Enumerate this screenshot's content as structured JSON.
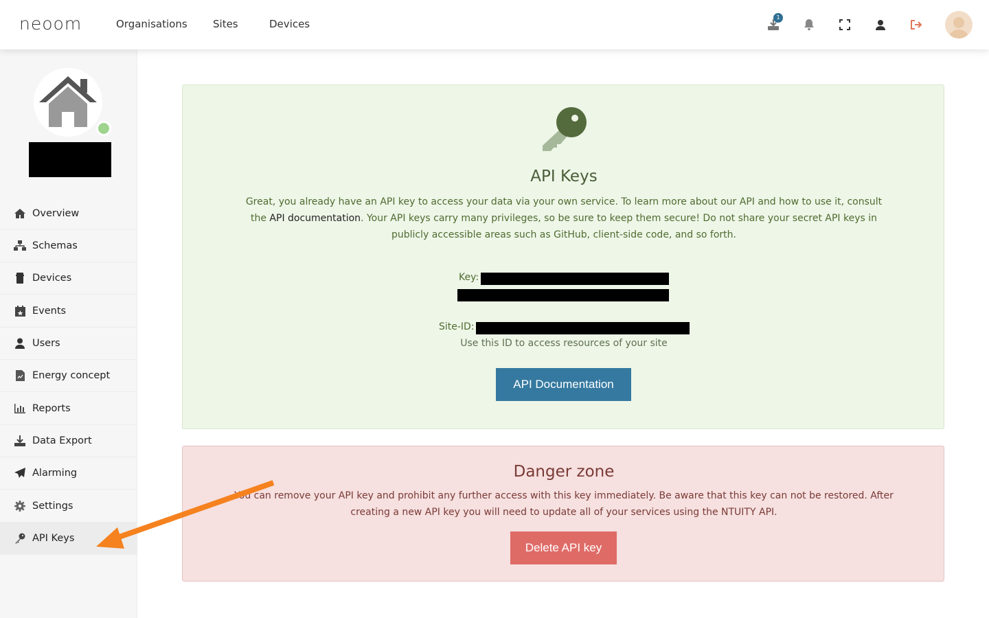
{
  "header": {
    "logo": "neoom",
    "nav": [
      "Organisations",
      "Sites",
      "Devices"
    ],
    "download_badge": "1",
    "icons": [
      "download-icon",
      "bell-icon",
      "fullscreen-icon",
      "user-icon",
      "logout-icon",
      "avatar"
    ]
  },
  "sidebar": {
    "items": [
      {
        "label": "Overview",
        "icon": "home-icon"
      },
      {
        "label": "Schemas",
        "icon": "schema-icon"
      },
      {
        "label": "Devices",
        "icon": "device-icon"
      },
      {
        "label": "Events",
        "icon": "calendar-icon"
      },
      {
        "label": "Users",
        "icon": "user-icon"
      },
      {
        "label": "Energy concept",
        "icon": "document-icon"
      },
      {
        "label": "Reports",
        "icon": "chart-icon"
      },
      {
        "label": "Data Export",
        "icon": "download-icon"
      },
      {
        "label": "Alarming",
        "icon": "paper-plane-icon"
      },
      {
        "label": "Settings",
        "icon": "gear-icon"
      },
      {
        "label": "API Keys",
        "icon": "key-icon",
        "active": true
      }
    ]
  },
  "api_card": {
    "title": "API Keys",
    "desc_part1": "Great, you already have an API key to access your data via your own service. To learn more about our API and how to use it, consult the ",
    "desc_link": "API documentation",
    "desc_part2": ". Your API keys carry many privileges, so be sure to keep them secure! Do not share your secret API keys in publicly accessible areas such as GitHub, client-side code, and so forth.",
    "key_label": "Key:",
    "site_id_label": "Site-ID:",
    "site_id_hint": "Use this ID to access resources of your site",
    "doc_button": "API Documentation"
  },
  "danger_zone": {
    "title": "Danger zone",
    "desc": "You can remove your API key and prohibit any further access with this key immediately. Be aware that this key can not be restored. After creating a new API key you will need to update all of your services using the NTUITY API.",
    "delete_button": "Delete API key"
  },
  "colors": {
    "accent_blue": "#3579a0",
    "danger_red": "#df6b67",
    "success_bg": "#eef6e8",
    "danger_bg": "#f6e0e0",
    "annotation_arrow": "#f5821f"
  }
}
